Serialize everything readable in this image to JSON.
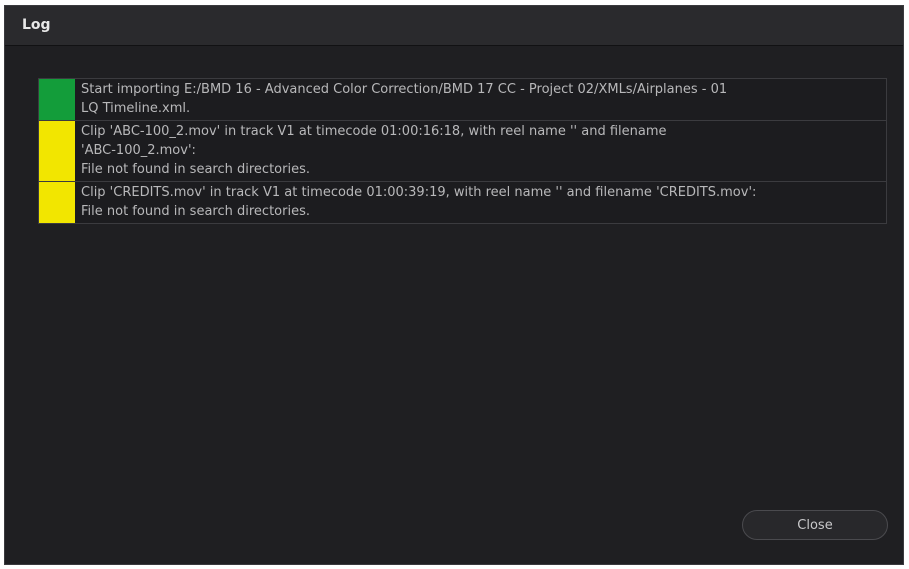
{
  "window": {
    "title": "Log"
  },
  "log": {
    "entries": [
      {
        "status": "success",
        "color": "#139d3a",
        "message": "Start importing E:/BMD 16 - Advanced Color Correction/BMD 17 CC - Project 02/XMLs/Airplanes - 01\nLQ Timeline.xml."
      },
      {
        "status": "warning",
        "color": "#f2e600",
        "message": "Clip 'ABC-100_2.mov' in track V1 at timecode 01:00:16:18, with reel name '' and filename\n'ABC-100_2.mov':\nFile not found in search directories."
      },
      {
        "status": "warning",
        "color": "#f2e600",
        "message": "Clip 'CREDITS.mov' in track V1 at timecode 01:00:39:19, with reel name '' and filename 'CREDITS.mov':\nFile not found in search directories."
      }
    ]
  },
  "footer": {
    "close_label": "Close"
  }
}
